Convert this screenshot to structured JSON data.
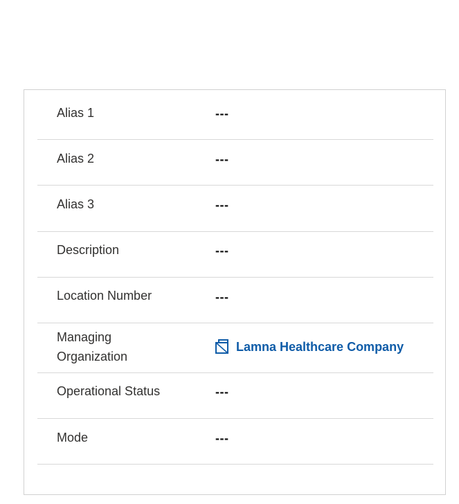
{
  "fields": [
    {
      "label": "Alias 1",
      "value": "---"
    },
    {
      "label": "Alias 2",
      "value": "---"
    },
    {
      "label": "Alias 3",
      "value": "---"
    },
    {
      "label": "Description",
      "value": "---"
    },
    {
      "label": "Location Number",
      "value": "---"
    },
    {
      "label": "Managing Organization",
      "value": "Lamna Healthcare Company",
      "icon": "entity-record-icon",
      "link_color": "#0f5ca8"
    },
    {
      "label": "Operational Status",
      "value": "---"
    },
    {
      "label": "Mode",
      "value": "---"
    }
  ]
}
